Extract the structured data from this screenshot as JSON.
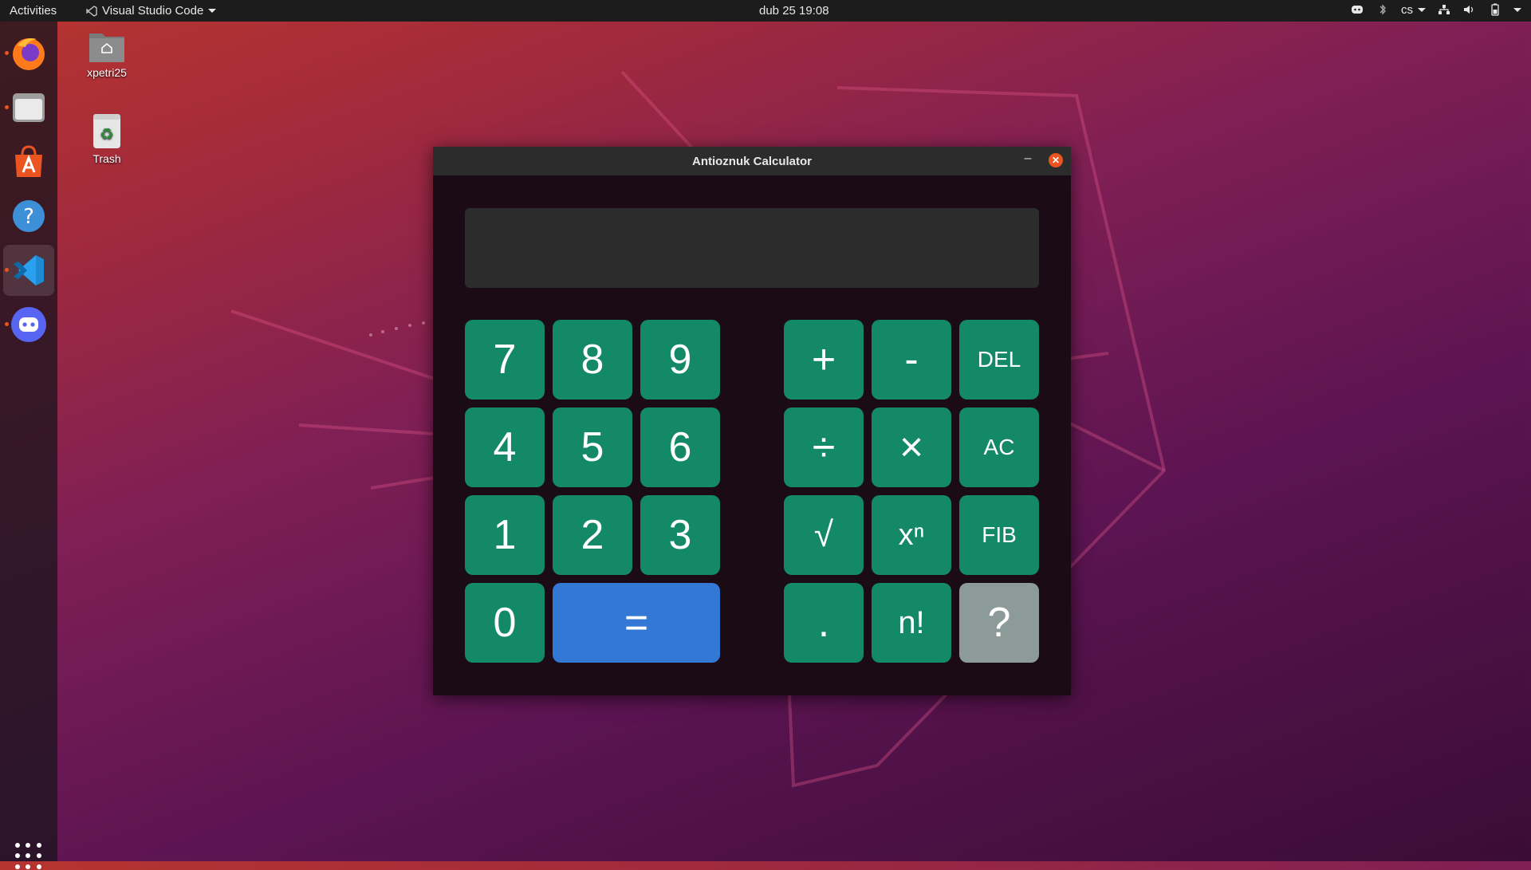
{
  "topbar": {
    "activities": "Activities",
    "app_name": "Visual Studio Code",
    "clock": "dub 25  19:08",
    "input_lang": "cs"
  },
  "dock": {
    "items": [
      "firefox-icon",
      "files-icon",
      "software-icon",
      "help-icon",
      "vscode-icon",
      "discord-icon"
    ]
  },
  "desktop": {
    "home_label": "xpetri25",
    "trash_label": "Trash"
  },
  "window": {
    "title": "Antioznuk Calculator",
    "minimize": "–",
    "close": "✕",
    "display_value": ""
  },
  "keys": {
    "k7": "7",
    "k8": "8",
    "k9": "9",
    "k4": "4",
    "k5": "5",
    "k6": "6",
    "k1": "1",
    "k2": "2",
    "k3": "3",
    "k0": "0",
    "equals": "=",
    "plus": "+",
    "minus": "-",
    "del": "DEL",
    "divide": "÷",
    "multiply": "×",
    "ac": "AC",
    "sqrt": "√",
    "power": "xⁿ",
    "fib": "FIB",
    "dot": ".",
    "factorial": "n!",
    "help": "?"
  },
  "colors": {
    "number_key": "#148968",
    "equals_key": "#3478d6",
    "help_key": "#8d9b98",
    "accent": "#e95420"
  }
}
